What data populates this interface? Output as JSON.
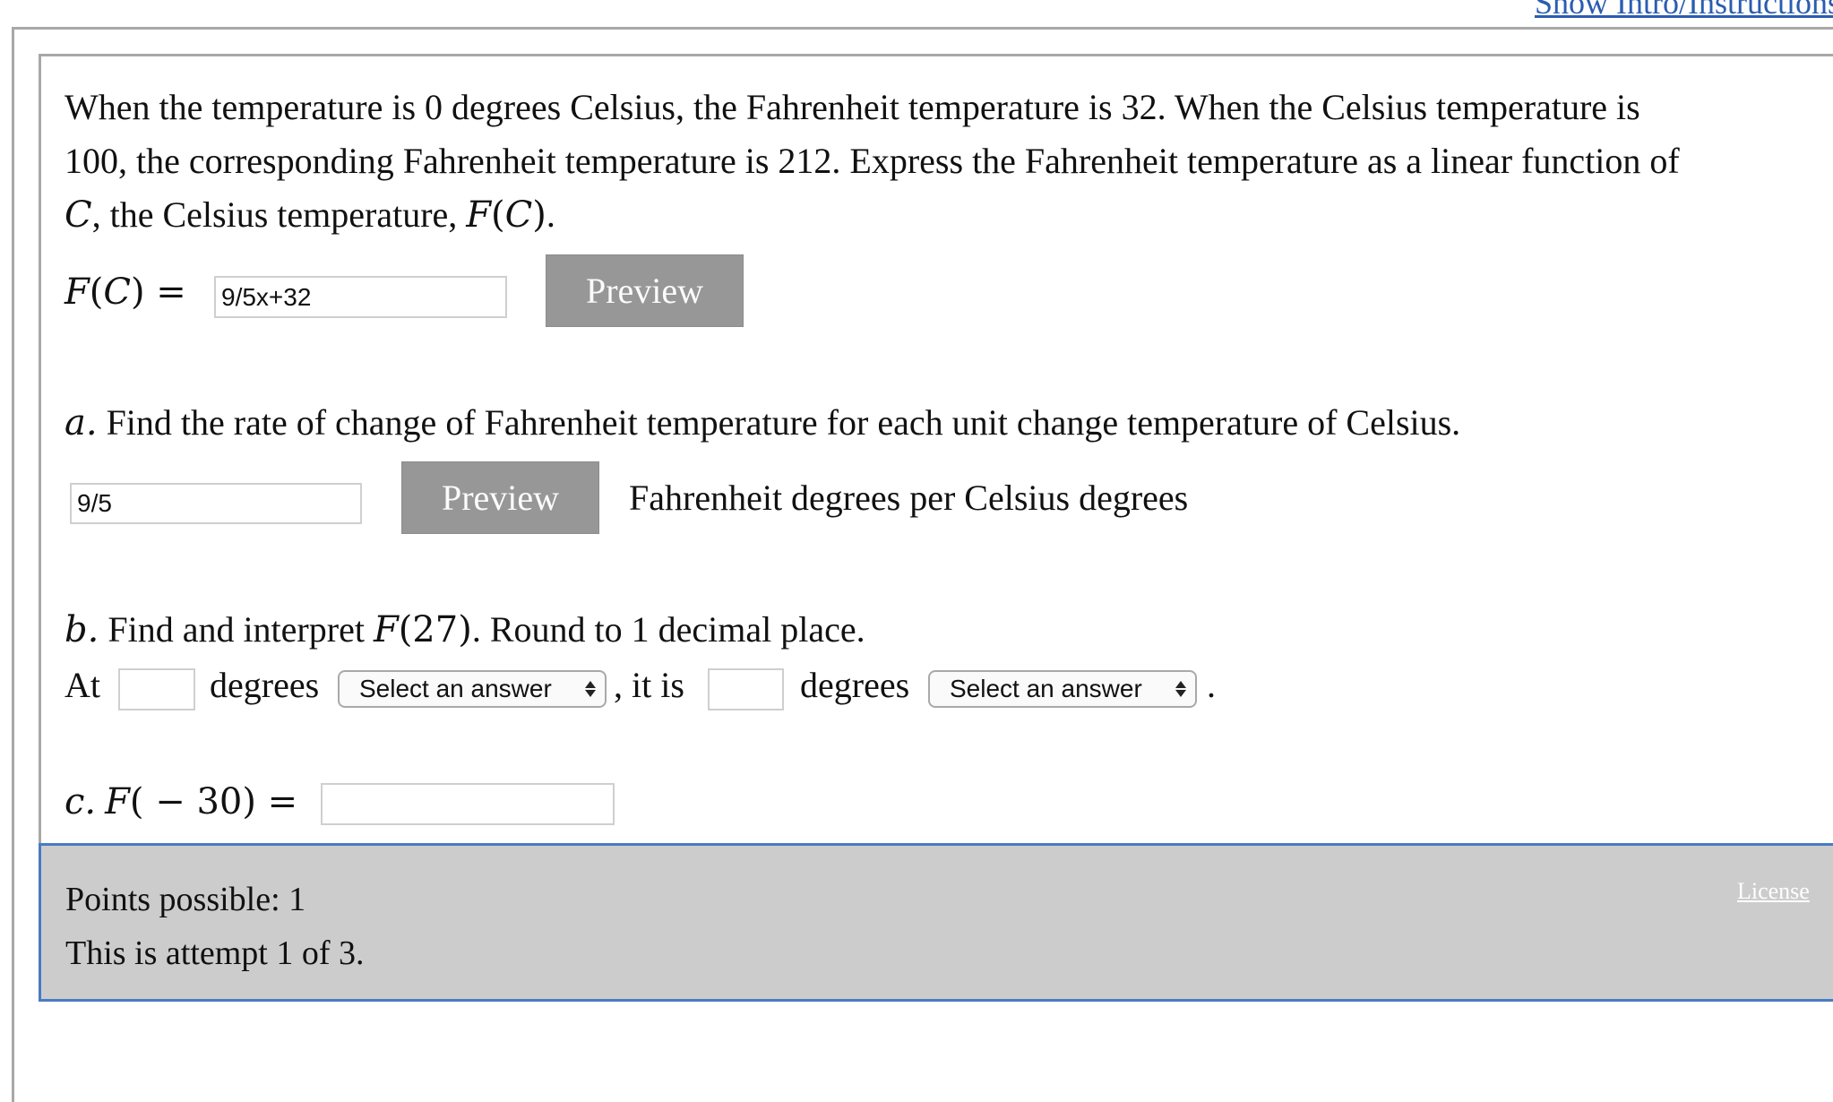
{
  "header": {
    "intro_link": "Show Intro/Instructions"
  },
  "question": {
    "prompt_line1": "When the temperature is 0 degrees Celsius, the Fahrenheit temperature is 32. When the Celsius temperature is",
    "prompt_line2": "100, the corresponding Fahrenheit temperature is 212. Express the Fahrenheit temperature as a linear function of",
    "prompt_line3_var": "C",
    "prompt_line3_mid": ", the Celsius temperature, ",
    "prompt_line3_fn": "F",
    "prompt_line3_arg": "C",
    "prompt_line3_end": ".",
    "fc_label_fn": "F",
    "fc_label_arg": "C",
    "fc_label_eq": " =",
    "fc_input_value": "9/5x+32",
    "preview_label": "Preview"
  },
  "part_a": {
    "label": "a.",
    "text": "Find the rate of change of Fahrenheit temperature for each unit change temperature of Celsius.",
    "input_value": "9/5",
    "preview_label": "Preview",
    "unit_text": "Fahrenheit degrees per Celsius degrees"
  },
  "part_b": {
    "label": "b.",
    "text_pre": "Find and interpret ",
    "fn": "F",
    "arg": "(27)",
    "text_post": ". Round to 1 decimal place.",
    "at_text": "At",
    "input1_value": "",
    "degrees1": "degrees",
    "select1_value": "Select an answer",
    "it_is_text": ", it is",
    "input2_value": "",
    "degrees2": "degrees",
    "select2_value": "Select an answer",
    "end_text": "."
  },
  "part_c": {
    "label": "c.",
    "fn": "F",
    "arg": "( − 30)",
    "eq": " =",
    "input_value": ""
  },
  "footer": {
    "points_possible": "Points possible: 1",
    "attempt": "This is attempt 1 of 3.",
    "license_link": "License"
  },
  "colors": {
    "preview_button": "#979797",
    "footer_bg": "#cccccc",
    "footer_border": "#4a7ac2",
    "link": "#2a5db0"
  }
}
